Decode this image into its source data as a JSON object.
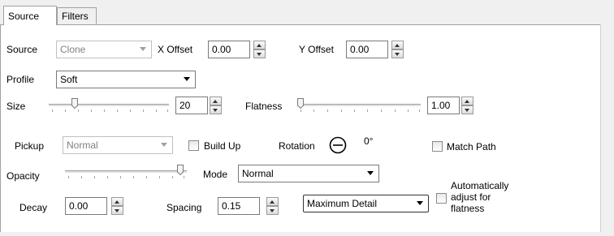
{
  "tabs": [
    {
      "label": "Source",
      "active": true
    },
    {
      "label": "Filters",
      "active": false
    }
  ],
  "source": {
    "label": "Source",
    "value": "Clone",
    "x_offset_label": "X Offset",
    "x_offset": "0.00",
    "y_offset_label": "Y Offset",
    "y_offset": "0.00"
  },
  "profile": {
    "label": "Profile",
    "value": "Soft"
  },
  "size": {
    "label": "Size",
    "value": "20"
  },
  "flatness": {
    "label": "Flatness",
    "value": "1.00"
  },
  "pickup": {
    "label": "Pickup",
    "value": "Normal"
  },
  "build_up": {
    "label": "Build Up",
    "checked": false
  },
  "rotation": {
    "label": "Rotation",
    "value": "0°"
  },
  "match_path": {
    "label": "Match Path",
    "checked": false
  },
  "opacity": {
    "label": "Opacity"
  },
  "mode": {
    "label": "Mode",
    "value": "Normal"
  },
  "decay": {
    "label": "Decay",
    "value": "0.00"
  },
  "spacing": {
    "label": "Spacing",
    "value": "0.15"
  },
  "detail": {
    "value": "Maximum Detail"
  },
  "auto_adjust": {
    "line1": "Automatically",
    "line2": "adjust for",
    "line3": "flatness",
    "checked": false
  },
  "icons": [
    "spin-up-icon",
    "spin-down-icon",
    "dropdown-arrow-icon",
    "slider-thumb-icon",
    "rotation-dial-icon"
  ]
}
